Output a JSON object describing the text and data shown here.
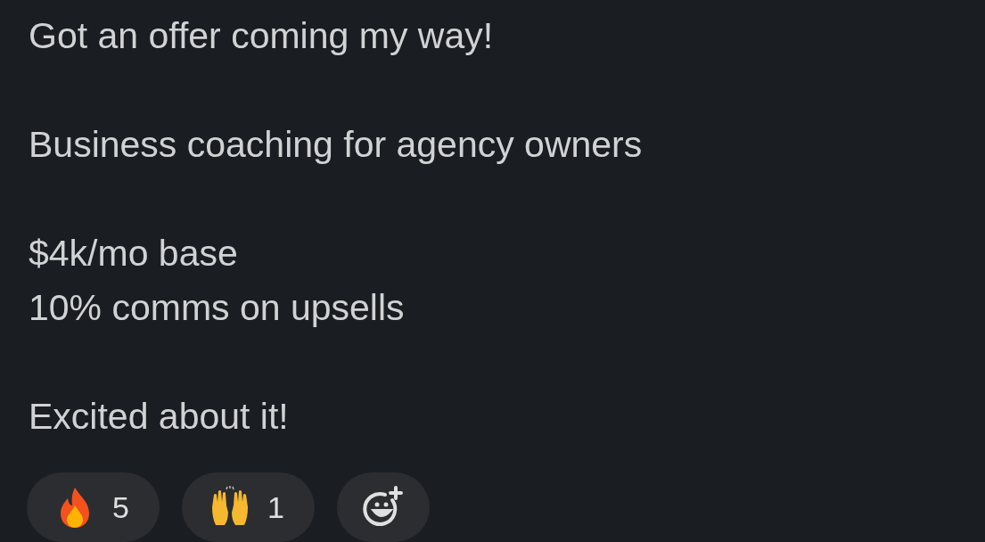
{
  "message": {
    "paragraphs": [
      "Got an offer coming my way!",
      "Business coaching for agency owners",
      "$4k/mo base\n10% comms on upsells",
      "Excited about it!"
    ]
  },
  "reactions": [
    {
      "kind": "fire",
      "count": "5"
    },
    {
      "kind": "raised-hands",
      "count": "1"
    },
    {
      "kind": "add"
    }
  ]
}
